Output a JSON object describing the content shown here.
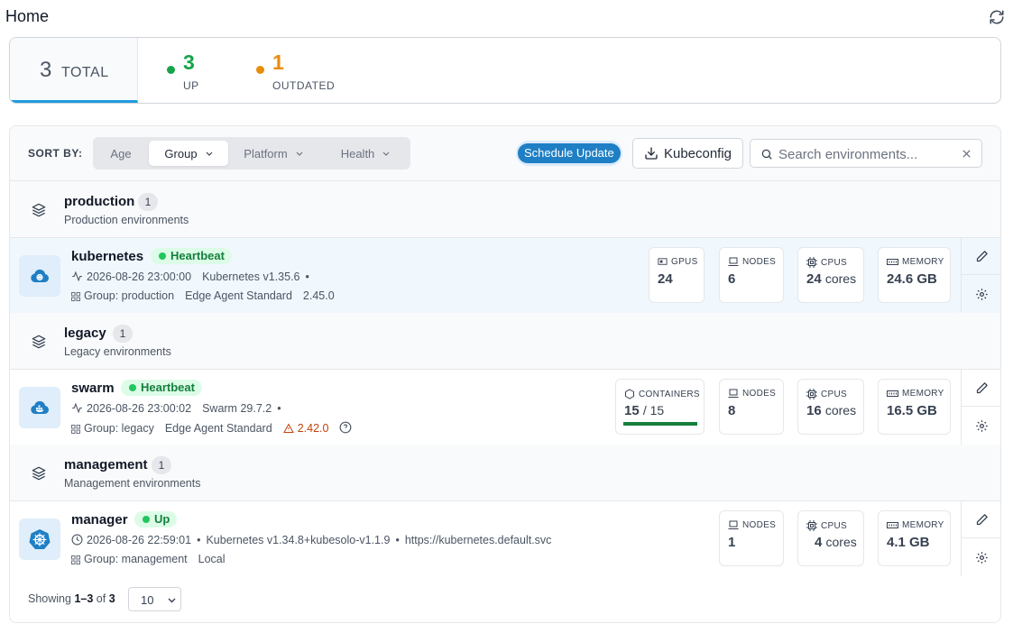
{
  "page": {
    "title": "Home"
  },
  "summary": {
    "total": {
      "count": "3",
      "label": "TOTAL"
    },
    "up": {
      "count": "3",
      "label": "UP",
      "color": "#16a34a"
    },
    "outdated": {
      "count": "1",
      "label": "OUTDATED",
      "color": "#ea8c0c"
    }
  },
  "toolbar": {
    "sort_label": "SORT BY:",
    "sort_options": [
      "Age",
      "Group",
      "Platform",
      "Health"
    ],
    "active_sort": "Group",
    "schedule_update": "Schedule Update",
    "kubeconfig": "Kubeconfig",
    "search_placeholder": "Search environments..."
  },
  "groups": [
    {
      "name": "production",
      "count": "1",
      "description": "Production environments",
      "env": {
        "name": "kubernetes",
        "status": "Heartbeat",
        "icon": "kubernetes-cloud-icon",
        "timestamp": "2026-08-26 23:00:00",
        "platform": "Kubernetes v1.35.6",
        "group": "Group: production",
        "agent": "Edge Agent Standard",
        "version": "2.45.0",
        "stats": [
          {
            "label": "GPUS",
            "value": "24",
            "unit": "",
            "icon": "gpu-icon"
          },
          {
            "label": "NODES",
            "value": "6",
            "unit": "",
            "icon": "laptop-icon"
          },
          {
            "label": "CPUS",
            "value": "24",
            "unit": "cores",
            "icon": "cpu-icon"
          },
          {
            "label": "MEMORY",
            "value": "24.6 GB",
            "unit": "",
            "icon": "memory-icon"
          }
        ]
      }
    },
    {
      "name": "legacy",
      "count": "1",
      "description": "Legacy environments",
      "env": {
        "name": "swarm",
        "status": "Heartbeat",
        "icon": "docker-cloud-icon",
        "timestamp": "2026-08-26 23:00:02",
        "platform": "Swarm 29.7.2",
        "group": "Group: legacy",
        "agent": "Edge Agent Standard",
        "version": "2.42.0",
        "containers": {
          "label": "CONTAINERS",
          "running": "15",
          "total": "/ 15",
          "fraction": 1.0
        },
        "stats": [
          {
            "label": "NODES",
            "value": "8",
            "unit": "",
            "icon": "laptop-icon"
          },
          {
            "label": "CPUS",
            "value": "16",
            "unit": "cores",
            "icon": "cpu-icon"
          },
          {
            "label": "MEMORY",
            "value": "16.5 GB",
            "unit": "",
            "icon": "memory-icon"
          }
        ]
      }
    },
    {
      "name": "management",
      "count": "1",
      "description": "Management environments",
      "env": {
        "name": "manager",
        "status": "Up",
        "icon": "kubernetes-helm-icon",
        "timestamp": "2026-08-26 22:59:01",
        "platform": "Kubernetes v1.34.8+kubesolo-v1.1.9",
        "url": "https://kubernetes.default.svc",
        "group": "Group: management",
        "agent": "Local",
        "stats": [
          {
            "label": "NODES",
            "value": "1",
            "unit": "",
            "icon": "laptop-icon"
          },
          {
            "label": "CPUS",
            "value": "4",
            "unit": "cores",
            "icon": "cpu-icon"
          },
          {
            "label": "MEMORY",
            "value": "4.1 GB",
            "unit": "",
            "icon": "memory-icon"
          }
        ]
      }
    }
  ],
  "pagination": {
    "showing": "Showing",
    "range": "1–3",
    "of": "of",
    "total": "3",
    "page_size": "10"
  }
}
